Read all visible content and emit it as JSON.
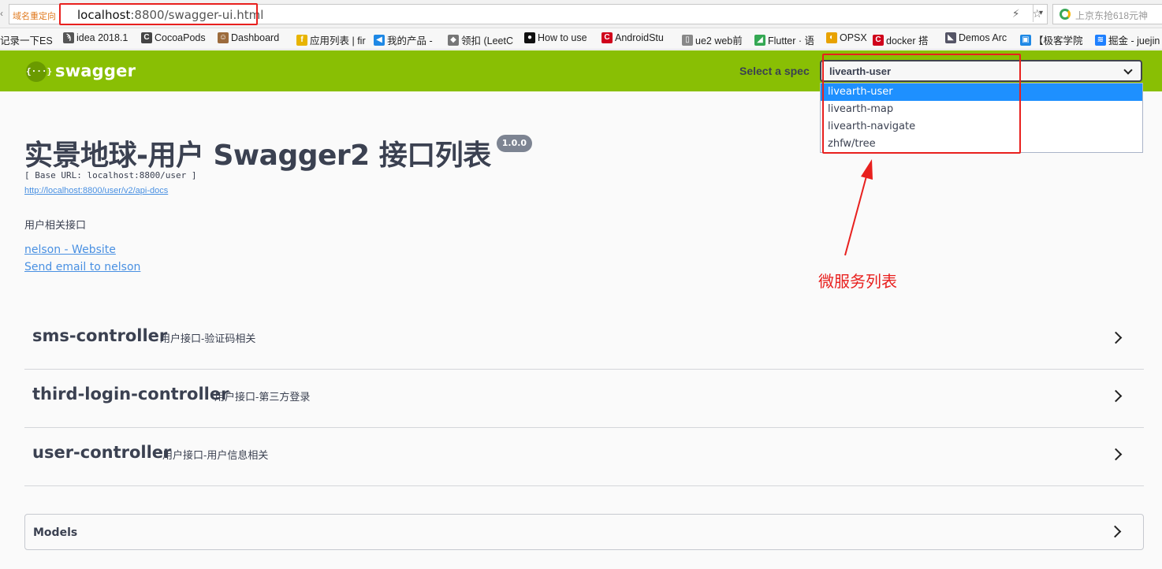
{
  "browser": {
    "back_glyph": "‹",
    "redirect_tag": "域名重定向",
    "url_host": "localhost",
    "url_rest": ":8800/swagger-ui.html",
    "url_icons": [
      "⚡",
      "☆"
    ],
    "dropdown_glyph": "▾",
    "search_text": "上京东抢618元神",
    "bookmarks": [
      {
        "label": "记录一下ES",
        "icon": "",
        "color": ""
      },
      {
        "label": "idea 2018.1",
        "icon": "ϡ",
        "color": "#555555"
      },
      {
        "label": "CocoaPods",
        "icon": "C",
        "color": "#444444"
      },
      {
        "label": "Dashboard",
        "icon": "☺",
        "color": "#9c6b3c"
      },
      {
        "label": "应用列表 | fir",
        "icon": "f",
        "color": "#e8b400"
      },
      {
        "label": "我的产品 -",
        "icon": "◀",
        "color": "#1e88e5"
      },
      {
        "label": "领扣 (LeetC",
        "icon": "◆",
        "color": "#777777"
      },
      {
        "label": "How to use",
        "icon": "●",
        "color": "#111111"
      },
      {
        "label": "AndroidStu",
        "icon": "C",
        "color": "#d0021b"
      },
      {
        "label": "ue2 web前",
        "icon": "▯",
        "color": "#888888"
      },
      {
        "label": "Flutter · 语",
        "icon": "◢",
        "color": "#34a853"
      },
      {
        "label": "OPSX",
        "icon": "◐",
        "color": "#e8a200"
      },
      {
        "label": "docker 搭",
        "icon": "C",
        "color": "#d0021b"
      },
      {
        "label": "Demos Arc",
        "icon": "◣",
        "color": "#556"
      },
      {
        "label": "【极客学院",
        "icon": "▣",
        "color": "#1e88e5"
      },
      {
        "label": "掘金 - juejin",
        "icon": "≋",
        "color": "#1e80ff"
      }
    ]
  },
  "topbar": {
    "logo_icon": "{···}",
    "logo_text": "swagger",
    "spec_label": "Select a spec",
    "spec_selected": "livearth-user",
    "spec_options": [
      "livearth-user",
      "livearth-map",
      "livearth-navigate",
      "zhfw/tree"
    ]
  },
  "info": {
    "title": "实景地球-用户 Swagger2 接口列表",
    "version": "1.0.0",
    "base_url": "[ Base URL: localhost:8800/user ]",
    "api_docs_url": "http://localhost:8800/user/v2/api-docs",
    "description": "用户相关接口",
    "contact_website": "nelson - Website",
    "contact_email": "Send email to nelson"
  },
  "controllers": [
    {
      "name": "sms-controller",
      "description": "用户接口-验证码相关"
    },
    {
      "name": "third-login-controller",
      "description": "用户接口-第三方登录"
    },
    {
      "name": "user-controller",
      "description": "用户接口-用户信息相关"
    }
  ],
  "models": {
    "label": "Models"
  },
  "annotation": {
    "text": "微服务列表",
    "color": "#e8201e"
  }
}
